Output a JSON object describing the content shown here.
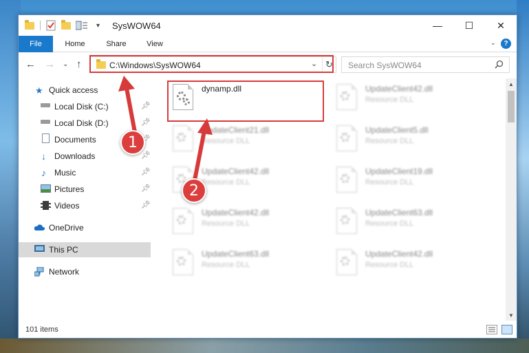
{
  "window": {
    "title": "SysWOW64",
    "controls": {
      "minimize": "—",
      "maximize": "☐",
      "close": "✕"
    }
  },
  "ribbon": {
    "tabs": [
      "File",
      "Home",
      "Share",
      "View"
    ],
    "help": "?"
  },
  "address": {
    "path": "C:\\Windows\\SysWOW64",
    "search_placeholder": "Search SysWOW64"
  },
  "nav": {
    "items": [
      {
        "label": "Quick access",
        "icon": "star-icon",
        "pinned": false
      },
      {
        "label": "Local Disk (C:)",
        "icon": "drive-icon",
        "pinned": true
      },
      {
        "label": "Local Disk (D:)",
        "icon": "drive-icon",
        "pinned": true
      },
      {
        "label": "Documents",
        "icon": "documents-icon",
        "pinned": true
      },
      {
        "label": "Downloads",
        "icon": "download-icon",
        "pinned": true
      },
      {
        "label": "Music",
        "icon": "music-icon",
        "pinned": true
      },
      {
        "label": "Pictures",
        "icon": "pictures-icon",
        "pinned": true
      },
      {
        "label": "Videos",
        "icon": "videos-icon",
        "pinned": true
      },
      {
        "label": "OneDrive",
        "icon": "cloud-icon",
        "pinned": false
      },
      {
        "label": "This PC",
        "icon": "monitor-icon",
        "pinned": false,
        "selected": true
      },
      {
        "label": "Network",
        "icon": "network-icon",
        "pinned": false
      }
    ]
  },
  "files": {
    "featured": {
      "name": "dynamp.dll"
    },
    "tiles": [
      {
        "name": "UpdateClient42.dll",
        "type": "Resource DLL"
      },
      {
        "name": "UpdateClient21.dll",
        "type": "Resource DLL"
      },
      {
        "name": "UpdateClient5.dll",
        "type": "Resource DLL"
      },
      {
        "name": "UpdateClient42.dll",
        "type": "Resource DLL"
      },
      {
        "name": "UpdateClient19.dll",
        "type": "Resource DLL"
      },
      {
        "name": "UpdateClient42.dll",
        "type": "Resource DLL"
      },
      {
        "name": "UpdateClient63.dll",
        "type": "Resource DLL"
      },
      {
        "name": "UpdateClient63.dll",
        "type": "Resource DLL"
      },
      {
        "name": "UpdateClient42.dll",
        "type": "Resource DLL"
      }
    ]
  },
  "status": {
    "item_count": "101 items"
  },
  "annotations": {
    "step1": "1",
    "step2": "2",
    "color": "#d73a3a"
  }
}
